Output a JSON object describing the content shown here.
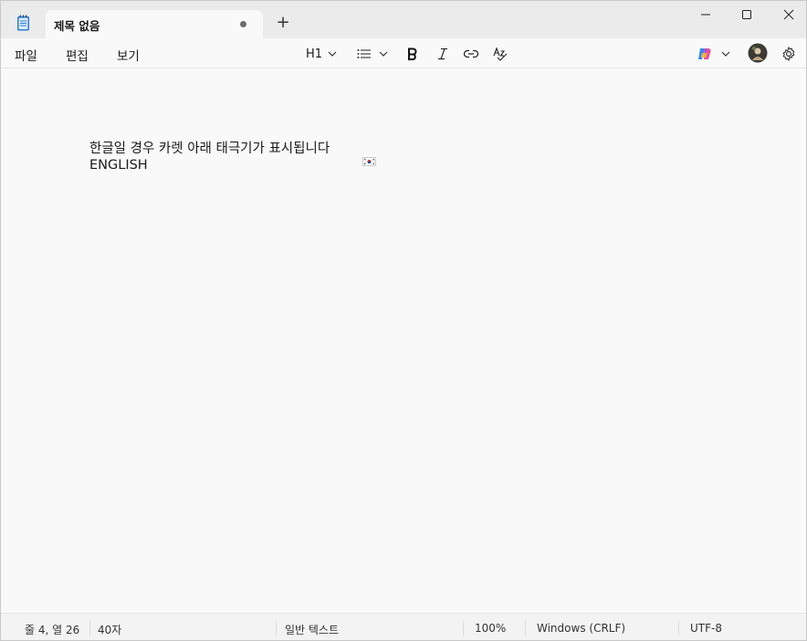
{
  "tab": {
    "title": "제목 없음"
  },
  "menu": [
    "파일",
    "편집",
    "보기"
  ],
  "toolbar": {
    "heading_label": "H1"
  },
  "editor": {
    "lines": [
      "한글일 경우 카렛 아래 태극기가 표시됩니다",
      "ENGLISH"
    ]
  },
  "status": {
    "position": "줄 4, 열 26",
    "chars": "40자",
    "format": "일반 텍스트",
    "zoom": "100%",
    "line_ending": "Windows (CRLF)",
    "encoding": "UTF-8"
  },
  "colors": {
    "titlebar": "#ebebeb",
    "editor_bg": "#f9f9f9",
    "notepad_icon": "#2b7cd3",
    "flag_red": "#cd2e3a",
    "flag_blue": "#0047a0"
  },
  "icons": [
    "notepad-icon",
    "close-tab-dot",
    "plus-icon",
    "minimize-icon",
    "maximize-icon",
    "close-icon",
    "list-icon",
    "bold-icon",
    "italic-icon",
    "link-icon",
    "spellcheck-icon",
    "copilot-icon",
    "avatar",
    "gear-icon",
    "korean-flag-icon"
  ]
}
